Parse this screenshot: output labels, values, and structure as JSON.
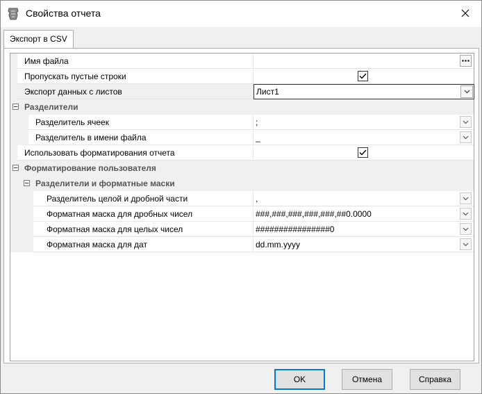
{
  "window": {
    "title": "Свойства отчета"
  },
  "tabs": [
    {
      "label": "Экспорт в CSV"
    }
  ],
  "properties": {
    "file_name": {
      "label": "Имя файла",
      "value": ""
    },
    "skip_empty_rows": {
      "label": "Пропускать пустые строки",
      "checked": true
    },
    "export_sheets": {
      "label": "Экспорт данных с листов",
      "value": "Лист1"
    },
    "separators": {
      "label": "Разделители",
      "cell_separator": {
        "label": "Разделитель ячеек",
        "value": ";"
      },
      "filename_separator": {
        "label": "Разделитель в имени файла",
        "value": "_"
      }
    },
    "use_report_formatting": {
      "label": "Использовать форматирования отчета",
      "checked": true
    },
    "user_formatting": {
      "label": "Форматирование пользователя",
      "masks_group": {
        "label": "Разделители и форматные маски",
        "decimal_separator": {
          "label": "Разделитель целой и дробной части",
          "value": ","
        },
        "fraction_mask": {
          "label": "Форматная маска для дробных чисел",
          "value": "###,###,###,###,###,##0.0000"
        },
        "integer_mask": {
          "label": "Форматная маска для целых чисел",
          "value": "################0"
        },
        "date_mask": {
          "label": "Форматная маска для дат",
          "value": "dd.mm.yyyy"
        }
      }
    }
  },
  "buttons": {
    "ok": "OK",
    "cancel": "Отмена",
    "help": "Справка"
  },
  "icons": {
    "app": "report-app-icon",
    "close": "close-icon",
    "dropdown": "chevron-down-icon",
    "ellipsis": "ellipsis-icon",
    "check": "check-icon",
    "collapse": "collapse-icon"
  },
  "colors": {
    "accent": "#0078d7",
    "category_bg": "#f0f0f0"
  }
}
